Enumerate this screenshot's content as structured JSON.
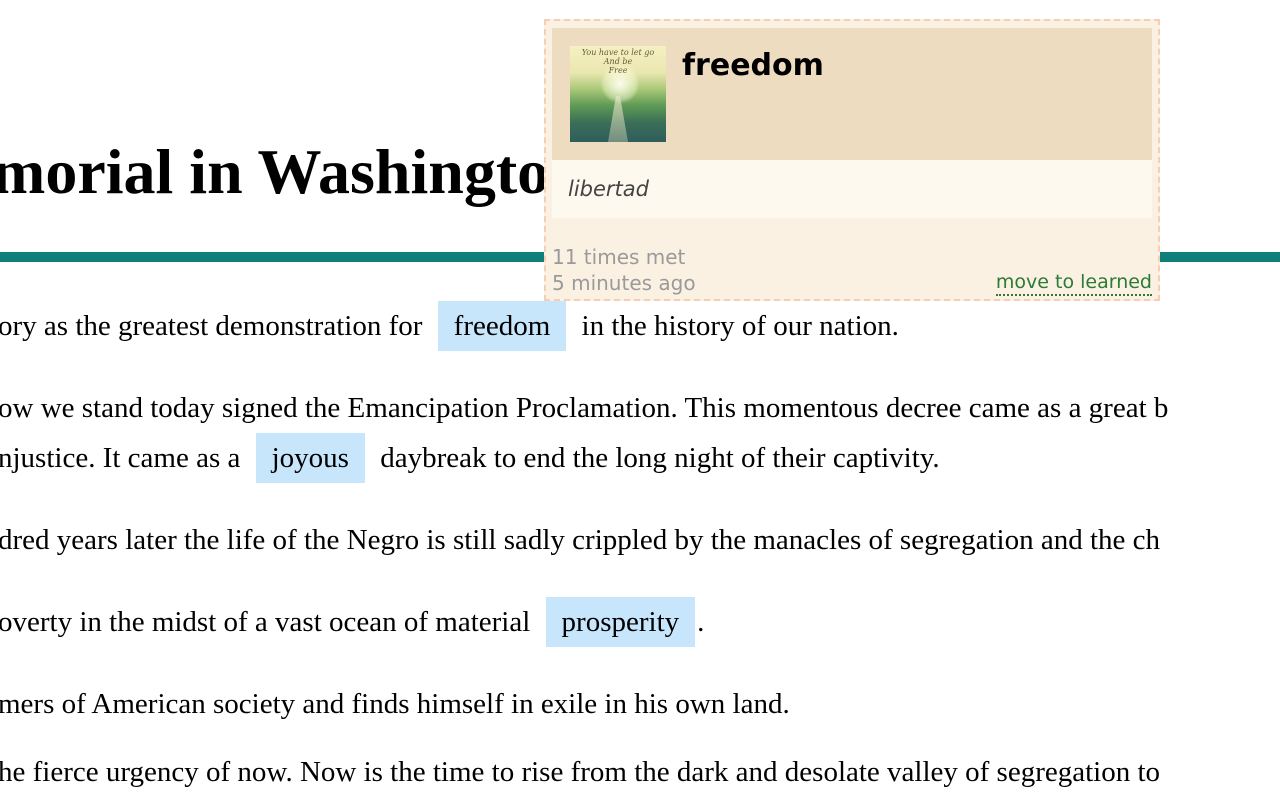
{
  "article": {
    "title": "morial in Washington",
    "paragraphs": [
      {
        "before": "ory as the greatest demonstration for ",
        "word": "freedom",
        "after": " in the history of our nation."
      },
      {
        "text": "ow we stand today signed the Emancipation Proclamation. This momentous decree came as a great b"
      },
      {
        "before": "njustice. It came as a ",
        "word": "joyous",
        "after": " daybreak to end the long night of their captivity."
      },
      {
        "text": "dred years later the life of the Negro is still sadly crippled by the manacles of segregation and the ch"
      },
      {
        "before": "overty in the midst of a vast ocean of material ",
        "word": "prosperity",
        "after": "."
      },
      {
        "text": "mers of American society and finds himself in exile in his own land."
      },
      {
        "text": "he fierce urgency of now. Now is the time to rise from the dark and desolate valley of segregation to"
      }
    ]
  },
  "popup": {
    "word": "freedom",
    "image_caption": [
      "You have to let go",
      "And be",
      "Free"
    ],
    "translation": "libertad",
    "times_met": "11 times met",
    "last_seen": "5 minutes ago",
    "move_label": "move to learned"
  },
  "colors": {
    "highlight": "#c7e6fb",
    "rule": "#0f7f7a",
    "popup_bg": "#faf1e3",
    "popup_header": "#eddcbf",
    "link_green": "#2c7a36"
  }
}
